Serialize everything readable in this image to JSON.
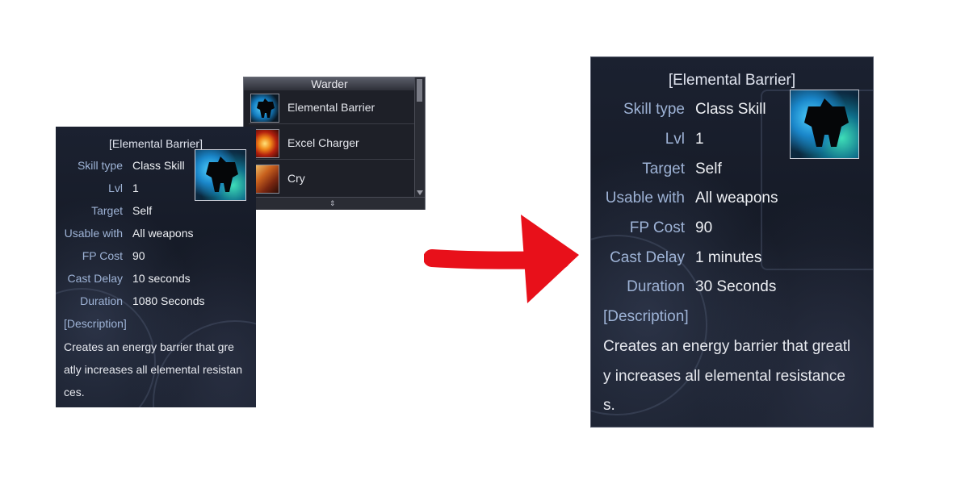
{
  "warder_window": {
    "title": "Warder",
    "skills": [
      {
        "label": "Elemental Barrier",
        "icon": "elemental-barrier-icon"
      },
      {
        "label": "Excel Charger",
        "icon": "excel-charger-icon"
      },
      {
        "label": "Cry",
        "icon": "cry-icon"
      }
    ]
  },
  "tooltip_before": {
    "title": "[Elemental Barrier]",
    "rows": [
      {
        "label": "Skill type",
        "value": "Class Skill"
      },
      {
        "label": "Lvl",
        "value": "1"
      },
      {
        "label": "Target",
        "value": "Self"
      },
      {
        "label": "Usable with",
        "value": "All weapons"
      },
      {
        "label": "FP Cost",
        "value": "90"
      },
      {
        "label": "Cast Delay",
        "value": "10 seconds"
      },
      {
        "label": "Duration",
        "value": "1080 Seconds"
      }
    ],
    "description_header": "[Description]",
    "description_lines": [
      "Creates an energy barrier that gre",
      "atly increases all elemental resistan",
      "ces."
    ]
  },
  "tooltip_after": {
    "title": "[Elemental Barrier]",
    "rows": [
      {
        "label": "Skill type",
        "value": "Class Skill"
      },
      {
        "label": "Lvl",
        "value": "1"
      },
      {
        "label": "Target",
        "value": "Self"
      },
      {
        "label": "Usable with",
        "value": "All weapons"
      },
      {
        "label": "FP Cost",
        "value": "90"
      },
      {
        "label": "Cast Delay",
        "value": "1 minutes"
      },
      {
        "label": "Duration",
        "value": "30 Seconds"
      }
    ],
    "description_header": "[Description]",
    "description_lines": [
      "Creates an energy barrier that greatl",
      "y increases all elemental resistance",
      "s."
    ]
  },
  "arrow_color": "#e8101a"
}
